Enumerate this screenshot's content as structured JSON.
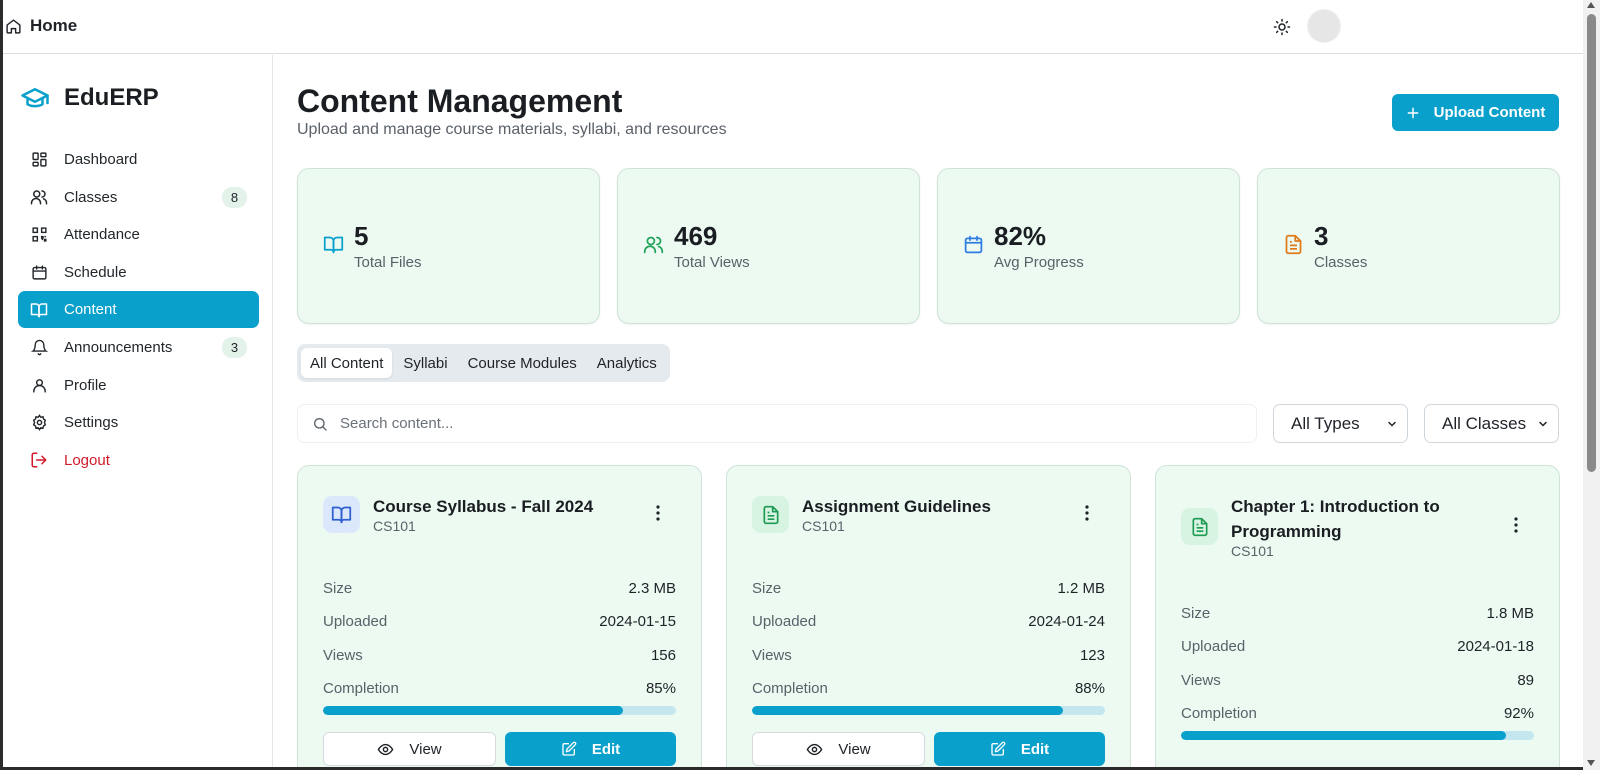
{
  "topbar": {
    "home_label": "Home"
  },
  "brand": {
    "name": "EduERP"
  },
  "sidebar": {
    "items": [
      {
        "label": "Dashboard",
        "icon": "dashboard-icon"
      },
      {
        "label": "Classes",
        "icon": "users-icon",
        "badge": "8"
      },
      {
        "label": "Attendance",
        "icon": "qr-code-icon"
      },
      {
        "label": "Schedule",
        "icon": "calendar-icon"
      },
      {
        "label": "Content",
        "icon": "book-open-icon",
        "active": true
      },
      {
        "label": "Announcements",
        "icon": "bell-icon",
        "badge": "3"
      },
      {
        "label": "Profile",
        "icon": "user-icon"
      },
      {
        "label": "Settings",
        "icon": "gear-icon"
      },
      {
        "label": "Logout",
        "icon": "logout-icon"
      }
    ]
  },
  "header": {
    "title": "Content Management",
    "subtitle": "Upload and manage course materials, syllabi, and resources",
    "upload_label": "Upload Content"
  },
  "stats": [
    {
      "value": "5",
      "label": "Total Files",
      "icon": "book-open-icon",
      "color": "#0aa0cc"
    },
    {
      "value": "469",
      "label": "Total Views",
      "icon": "users-icon",
      "color": "#22a35a"
    },
    {
      "value": "82%",
      "label": "Avg Progress",
      "icon": "calendar-icon",
      "color": "#2f7de1"
    },
    {
      "value": "3",
      "label": "Classes",
      "icon": "file-text-icon",
      "color": "#e07b1a"
    }
  ],
  "tabs": [
    "All Content",
    "Syllabi",
    "Course Modules",
    "Analytics"
  ],
  "search": {
    "placeholder": "Search content..."
  },
  "filters": {
    "type": "All Types",
    "class": "All Classes"
  },
  "card_labels": {
    "size": "Size",
    "uploaded": "Uploaded",
    "views": "Views",
    "completion": "Completion",
    "view": "View",
    "edit": "Edit"
  },
  "cards": [
    {
      "title": "Course Syllabus - Fall 2024",
      "code": "CS101",
      "size": "2.3 MB",
      "uploaded": "2024-01-15",
      "views": "156",
      "completion": "85%",
      "completion_value": 85,
      "icon": "book-open-icon"
    },
    {
      "title": "Assignment Guidelines",
      "code": "CS101",
      "size": "1.2 MB",
      "uploaded": "2024-01-24",
      "views": "123",
      "completion": "88%",
      "completion_value": 88,
      "icon": "file-text-icon"
    },
    {
      "title": "Chapter 1: Introduction to Programming",
      "code": "CS101",
      "size": "1.8 MB",
      "uploaded": "2024-01-18",
      "views": "89",
      "completion": "92%",
      "completion_value": 92,
      "icon": "file-text-icon"
    }
  ],
  "colors": {
    "accent": "#0aa0cc",
    "card_bg": "#ecfaf2",
    "logout": "#d11a2a"
  }
}
